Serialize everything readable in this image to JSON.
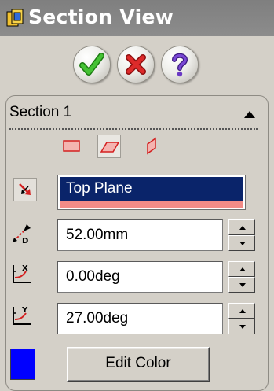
{
  "window": {
    "title": "Section View",
    "title_icon": "section-view-icon"
  },
  "actions": {
    "ok": {
      "icon": "checkmark-icon",
      "color": "#2fa021"
    },
    "cancel": {
      "icon": "x-icon",
      "color": "#c81e1e"
    },
    "help": {
      "icon": "question-icon",
      "color": "#5a2aa8"
    }
  },
  "section": {
    "label": "Section 1",
    "collapse_icon": "collapse-up-icon",
    "plane_tools": [
      {
        "icon": "front-plane-icon",
        "selected": false
      },
      {
        "icon": "top-plane-icon",
        "selected": true
      },
      {
        "icon": "right-plane-icon",
        "selected": false
      }
    ],
    "reverse_icon": "reverse-direction-icon",
    "reference": {
      "value": "Top Plane",
      "highlight": "#0a246a",
      "preview_color": "#f28b87"
    },
    "offset": {
      "icon": "offset-distance-icon",
      "value": "52.00mm"
    },
    "rotation_x": {
      "icon": "rotate-x-icon",
      "value": "0.00deg"
    },
    "rotation_y": {
      "icon": "rotate-y-icon",
      "value": "27.00deg"
    },
    "color": {
      "swatch": "#0000ff",
      "edit_label": "Edit Color"
    }
  }
}
